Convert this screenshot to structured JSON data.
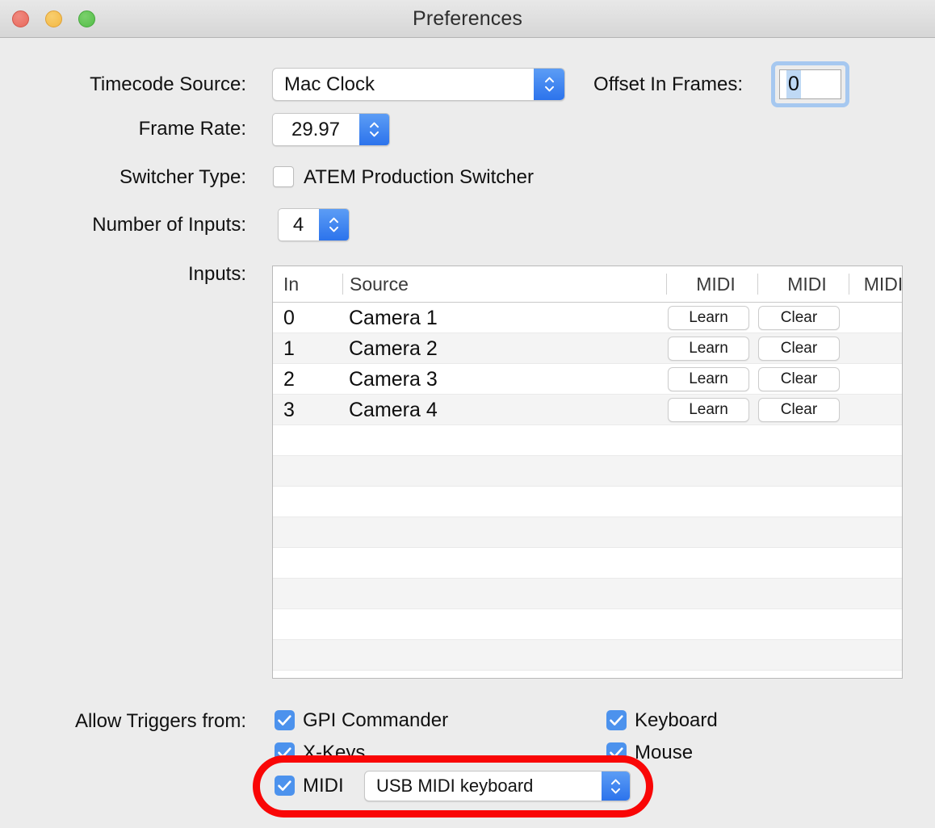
{
  "window": {
    "title": "Preferences",
    "traffic_lights": [
      {
        "name": "close",
        "color": "#E8695C"
      },
      {
        "name": "minimize",
        "color": "#F3B844"
      },
      {
        "name": "maximize",
        "color": "#53BE48"
      }
    ]
  },
  "form": {
    "timecode_source": {
      "label": "Timecode Source:",
      "value": "Mac Clock"
    },
    "offset_in_frames": {
      "label": "Offset In Frames:",
      "value": "0"
    },
    "frame_rate": {
      "label": "Frame Rate:",
      "value": "29.97"
    },
    "switcher_type": {
      "label": "Switcher Type:",
      "checkbox_label": "ATEM Production Switcher",
      "checked": false
    },
    "number_of_inputs": {
      "label": "Number of Inputs:",
      "value": "4"
    },
    "inputs": {
      "label": "Inputs:"
    }
  },
  "table": {
    "columns": [
      "In",
      "Source",
      "MIDI",
      "MIDI",
      "MIDI"
    ],
    "rows": [
      {
        "in": "0",
        "source": "Camera 1",
        "learn": "Learn",
        "clear": "Clear"
      },
      {
        "in": "1",
        "source": "Camera 2",
        "learn": "Learn",
        "clear": "Clear"
      },
      {
        "in": "2",
        "source": "Camera 3",
        "learn": "Learn",
        "clear": "Clear"
      },
      {
        "in": "3",
        "source": "Camera 4",
        "learn": "Learn",
        "clear": "Clear"
      }
    ],
    "empty_row_count": 9
  },
  "triggers": {
    "label": "Allow Triggers from:",
    "items": [
      {
        "label": "GPI Commander",
        "checked": true
      },
      {
        "label": "Keyboard",
        "checked": true
      },
      {
        "label": "X-Keys",
        "checked": true
      },
      {
        "label": "Mouse",
        "checked": true
      },
      {
        "label": "MIDI",
        "checked": true
      }
    ],
    "midi_device": "USB MIDI keyboard"
  },
  "annotation": {
    "color": "#F90606",
    "shape": "rounded-rect-outline"
  },
  "colors": {
    "window_background": "#ECECEC",
    "accent_blue": "#4C92ED",
    "stepper_blue_top": "#5C9DF5",
    "stepper_blue_bottom": "#2C73EC",
    "focus_ring": "#A6C8F0",
    "row_alt": "#F4F4F4"
  }
}
